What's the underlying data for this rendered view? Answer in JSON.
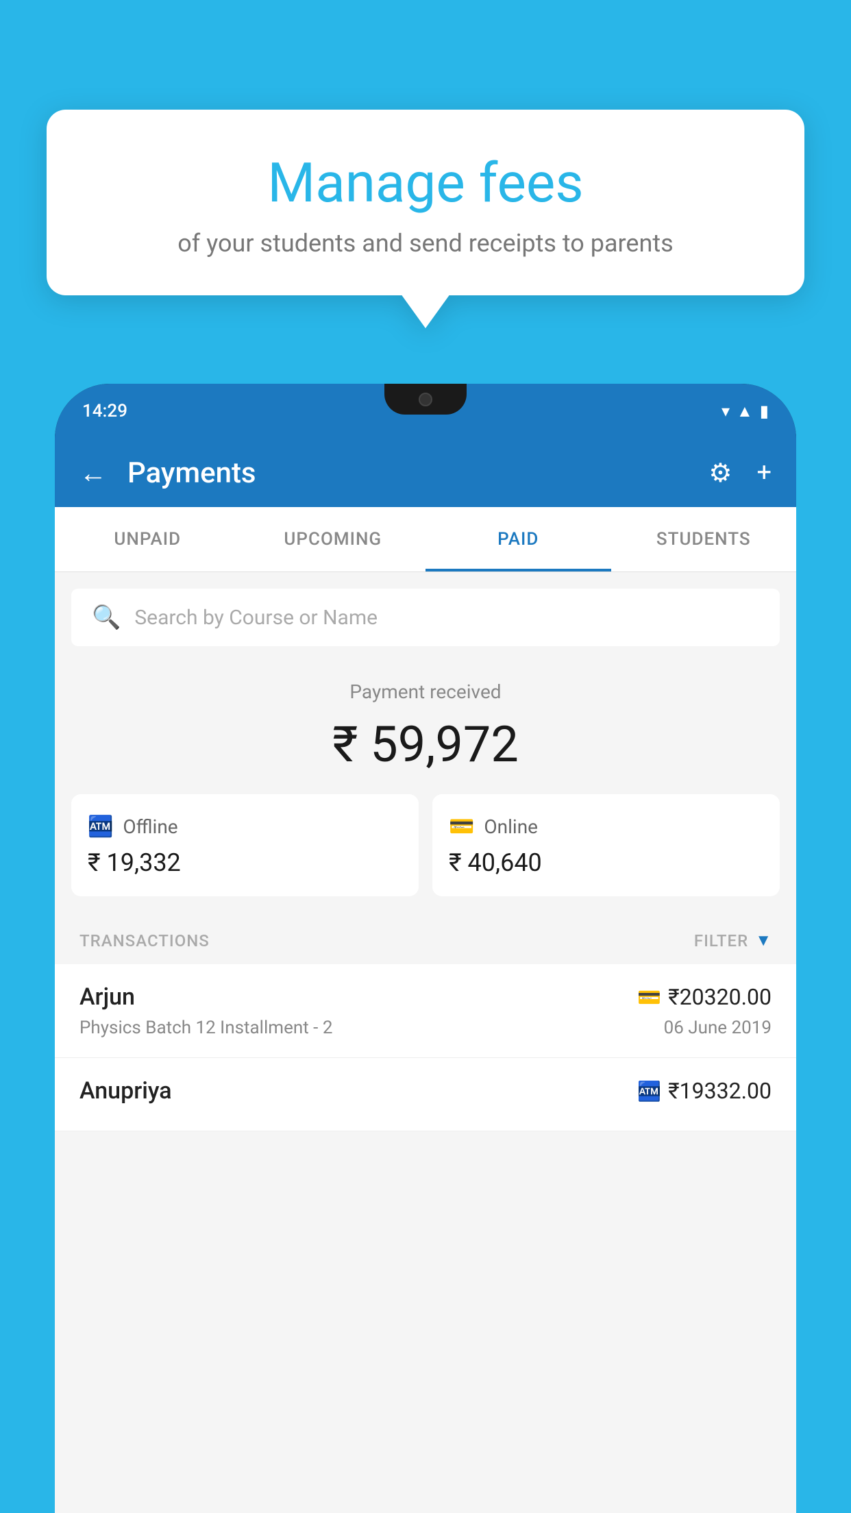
{
  "background_color": "#29B6E8",
  "bubble": {
    "title": "Manage fees",
    "subtitle": "of your students and send receipts to parents"
  },
  "phone": {
    "status_bar": {
      "time": "14:29"
    },
    "header": {
      "title": "Payments",
      "back_label": "←",
      "settings_icon": "gear",
      "add_icon": "+"
    },
    "tabs": [
      {
        "label": "UNPAID",
        "active": false
      },
      {
        "label": "UPCOMING",
        "active": false
      },
      {
        "label": "PAID",
        "active": true
      },
      {
        "label": "STUDENTS",
        "active": false
      }
    ],
    "search": {
      "placeholder": "Search by Course or Name"
    },
    "payment": {
      "label": "Payment received",
      "amount": "₹ 59,972",
      "offline_label": "Offline",
      "offline_amount": "₹ 19,332",
      "online_label": "Online",
      "online_amount": "₹ 40,640"
    },
    "transactions": {
      "header_label": "TRANSACTIONS",
      "filter_label": "FILTER",
      "items": [
        {
          "name": "Arjun",
          "detail": "Physics Batch 12 Installment - 2",
          "amount": "₹20320.00",
          "date": "06 June 2019",
          "payment_type": "card"
        },
        {
          "name": "Anupriya",
          "detail": "",
          "amount": "₹19332.00",
          "date": "",
          "payment_type": "cash"
        }
      ]
    }
  }
}
